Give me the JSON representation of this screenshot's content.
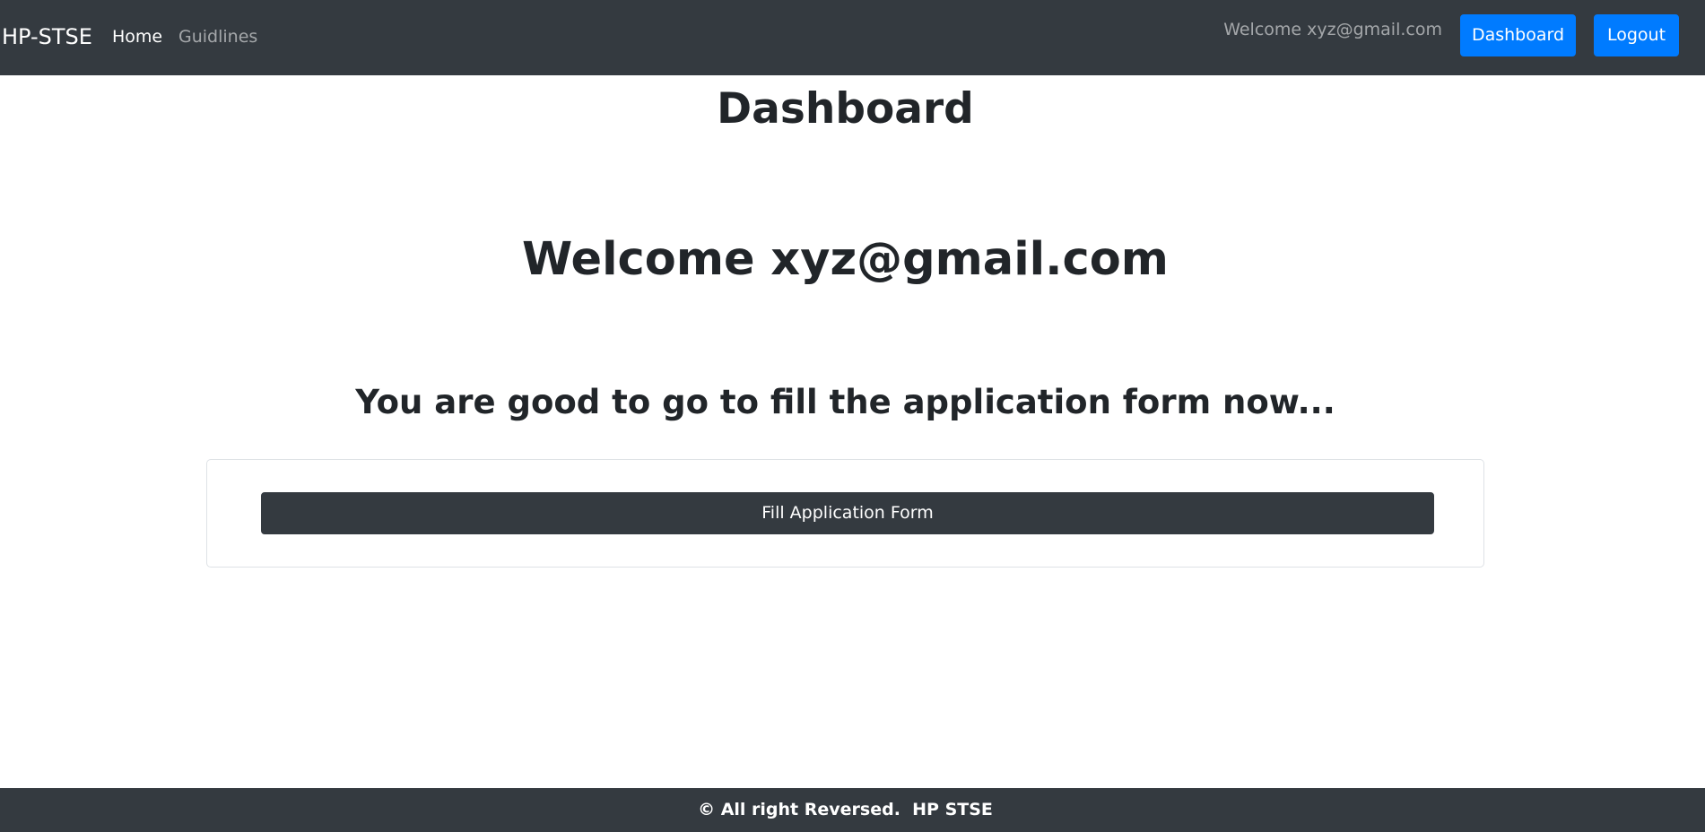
{
  "navbar": {
    "brand": "HP-STSE",
    "links": [
      "Home",
      "Guidlines"
    ],
    "welcome": "Welcome xyz@gmail.com",
    "dashboard_button": "Dashboard",
    "logout_button": "Logout"
  },
  "main": {
    "title": "Dashboard",
    "welcome": "Welcome xyz@gmail.com",
    "message": "You are good to go to fill the application form now...",
    "fill_button": "Fill Application Form"
  },
  "footer": {
    "text": "© All right Reversed.  HP STSE"
  },
  "colors": {
    "navbar_bg": "#343a40",
    "primary": "#007bff",
    "text": "#212529",
    "card_border": "#dee2e6"
  }
}
